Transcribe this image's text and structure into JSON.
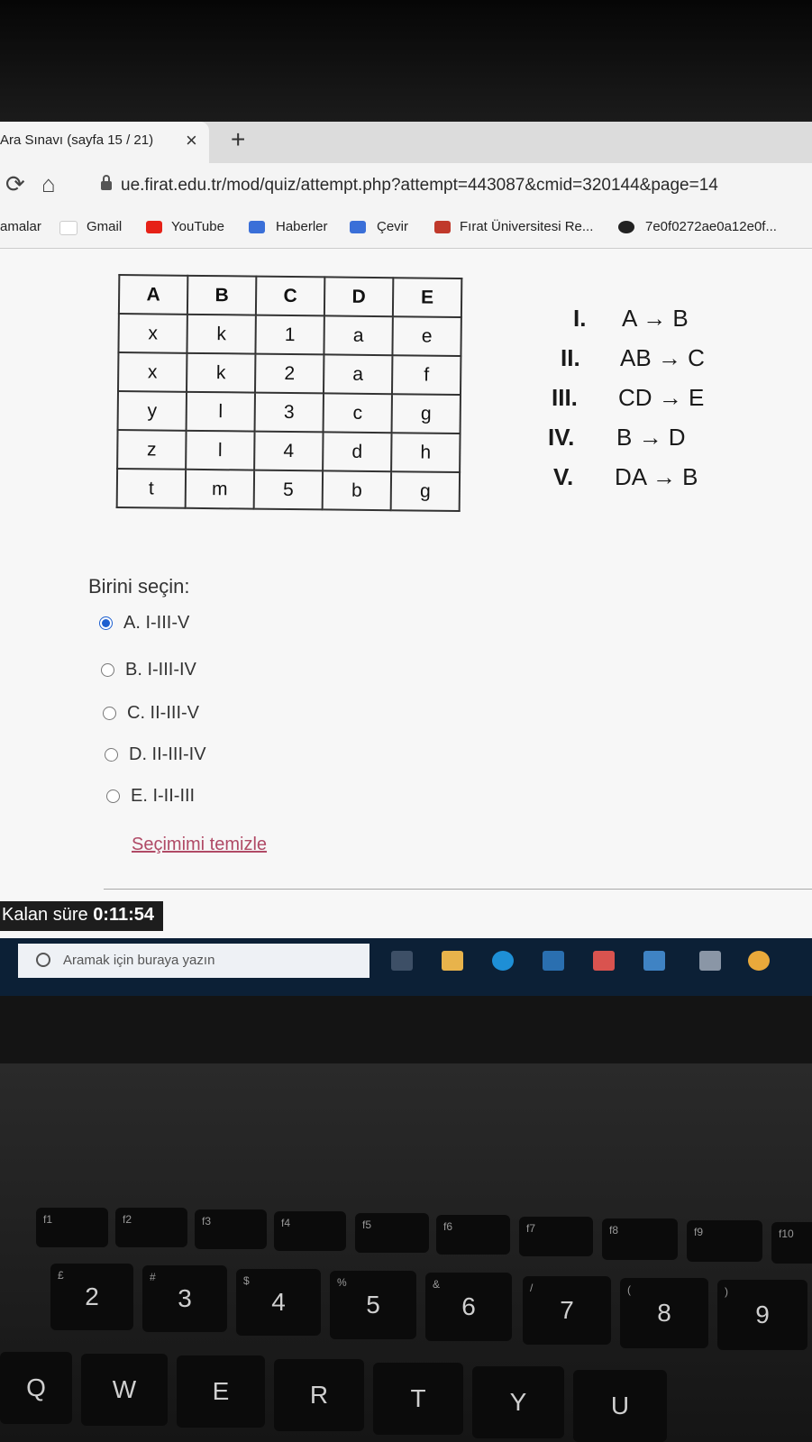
{
  "browser": {
    "tab_title": "Ara Sınavı (sayfa 15 / 21)",
    "tab_close": "×",
    "new_tab": "+",
    "url": "ue.firat.edu.tr/mod/quiz/attempt.php?attempt=443087&cmid=320144&page=14",
    "bookmarks": [
      {
        "label": "amalar",
        "icon": "apps-icon"
      },
      {
        "label": "Gmail",
        "icon": "gmail-icon"
      },
      {
        "label": "YouTube",
        "icon": "youtube-icon"
      },
      {
        "label": "Haberler",
        "icon": "news-icon"
      },
      {
        "label": "Çevir",
        "icon": "translate-icon"
      },
      {
        "label": "Fırat Üniversitesi Re...",
        "icon": "firat-icon"
      },
      {
        "label": "7e0f0272ae0a12e0f...",
        "icon": "github-icon"
      }
    ]
  },
  "question": {
    "table": {
      "headers": [
        "A",
        "B",
        "C",
        "D",
        "E"
      ],
      "rows": [
        [
          "x",
          "k",
          "1",
          "a",
          "e"
        ],
        [
          "x",
          "k",
          "2",
          "a",
          "f"
        ],
        [
          "y",
          "l",
          "3",
          "c",
          "g"
        ],
        [
          "z",
          "l",
          "4",
          "d",
          "h"
        ],
        [
          "t",
          "m",
          "5",
          "b",
          "g"
        ]
      ]
    },
    "dependencies": [
      {
        "num": "I.",
        "expr": "A → B"
      },
      {
        "num": "II.",
        "expr": "AB → C"
      },
      {
        "num": "III.",
        "expr": "CD → E"
      },
      {
        "num": "IV.",
        "expr": "B → D"
      },
      {
        "num": "V.",
        "expr": "DA → B"
      }
    ],
    "prompt": "Birini seçin:",
    "options": [
      {
        "label": "A. I-III-V",
        "selected": true
      },
      {
        "label": "B. I-III-IV",
        "selected": false
      },
      {
        "label": "C. II-III-V",
        "selected": false
      },
      {
        "label": "D. II-III-IV",
        "selected": false
      },
      {
        "label": "E. I-II-III",
        "selected": false
      }
    ],
    "clear_choice": "Seçimimi temizle"
  },
  "timer": {
    "label": "Kalan süre",
    "value": "0:11:54"
  },
  "taskbar": {
    "search_placeholder": "Aramak için buraya yazın"
  },
  "keyboard": {
    "function_row": [
      "f1",
      "f2",
      "f3",
      "f4",
      "f5",
      "f6",
      "f7",
      "f8",
      "f9",
      "f10"
    ],
    "number_row": [
      {
        "main": "2",
        "sub": "£"
      },
      {
        "main": "3",
        "sub": "#"
      },
      {
        "main": "4",
        "sub": "$"
      },
      {
        "main": "5",
        "sub": "%"
      },
      {
        "main": "6",
        "sub": "&"
      },
      {
        "main": "7",
        "sub": "/"
      },
      {
        "main": "8",
        "sub": "("
      },
      {
        "main": "9",
        "sub": ")"
      }
    ],
    "letter_row": [
      "Q",
      "W",
      "E",
      "R",
      "T",
      "Y",
      "U"
    ]
  }
}
